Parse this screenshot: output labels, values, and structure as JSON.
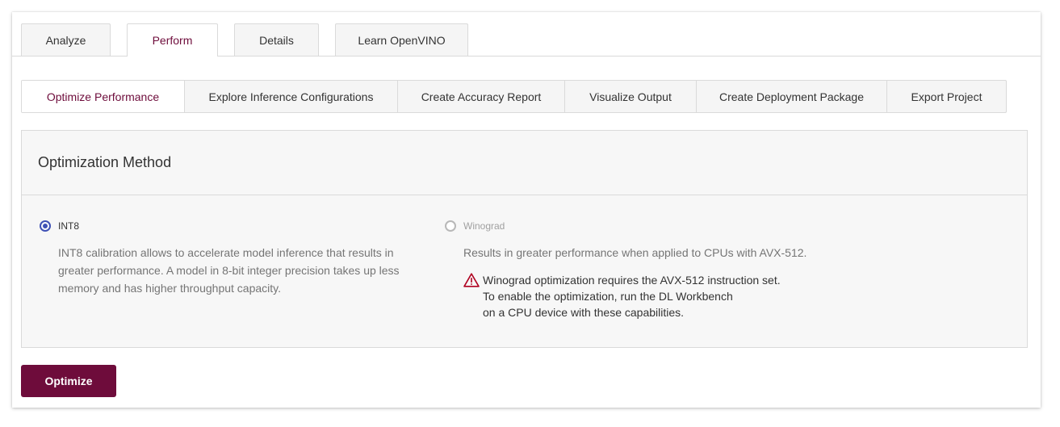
{
  "main_tabs": [
    {
      "label": "Analyze",
      "active": false
    },
    {
      "label": "Perform",
      "active": true
    },
    {
      "label": "Details",
      "active": false
    },
    {
      "label": "Learn OpenVINO",
      "active": false
    }
  ],
  "sub_tabs": [
    {
      "label": "Optimize Performance",
      "active": true
    },
    {
      "label": "Explore Inference Configurations",
      "active": false
    },
    {
      "label": "Create Accuracy Report",
      "active": false
    },
    {
      "label": "Visualize Output",
      "active": false
    },
    {
      "label": "Create Deployment Package",
      "active": false
    },
    {
      "label": "Export Project",
      "active": false
    }
  ],
  "panel": {
    "title": "Optimization Method",
    "options": [
      {
        "label": "INT8",
        "selected": true,
        "disabled": false,
        "description_lines": [
          "INT8 calibration allows to accelerate model inference that results in",
          "greater performance. A model in 8-bit integer precision takes up less",
          "memory and has higher throughput capacity."
        ]
      },
      {
        "label": "Winograd",
        "selected": false,
        "disabled": true,
        "description_lines": [
          "Results in greater performance when applied to CPUs with AVX-512."
        ],
        "warning_icon": "warning-triangle-icon",
        "warning_lines": [
          "Winograd optimization requires the AVX-512 instruction set.",
          "To enable the optimization, run the DL Workbench",
          "on a CPU device with these capabilities."
        ]
      }
    ]
  },
  "optimize_button": "Optimize",
  "colors": {
    "brand": "#6e0c3b",
    "radio_selected": "#3f51b5",
    "warning": "#b00020"
  }
}
